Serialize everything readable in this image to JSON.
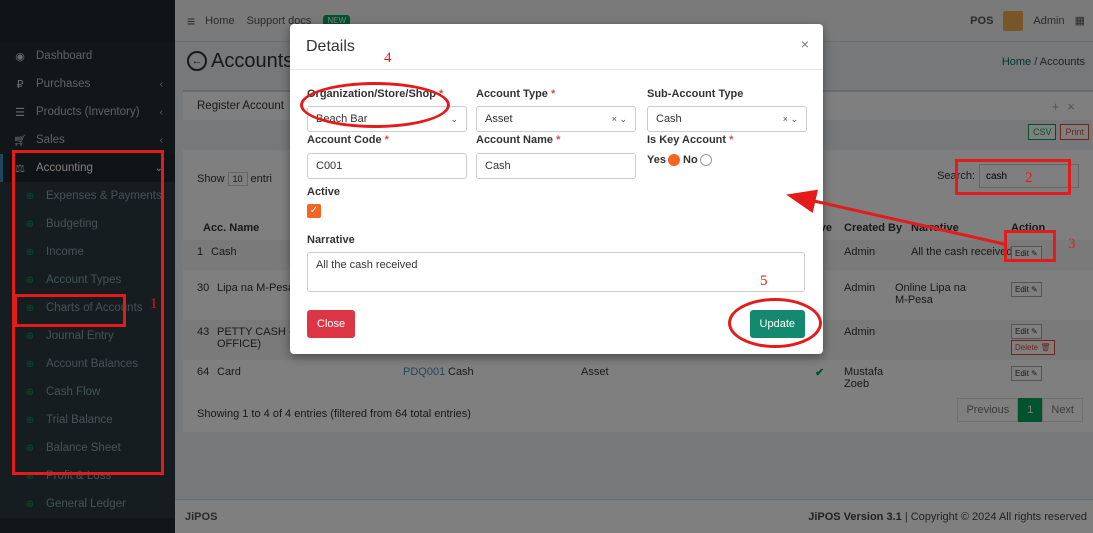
{
  "topbar": {
    "home": "Home",
    "support": "Support docs",
    "badge": "NEW",
    "pos": "POS",
    "user": "Admin",
    "grid_icon": "▦"
  },
  "sidebar": {
    "items": [
      {
        "label": "Dashboard",
        "icon": "dashboard-icon"
      },
      {
        "label": "Purchases",
        "icon": "purchases-icon"
      },
      {
        "label": "Products (Inventory)",
        "icon": "products-icon"
      },
      {
        "label": "Sales",
        "icon": "sales-icon"
      },
      {
        "label": "Accounting",
        "icon": "accounting-icon"
      }
    ],
    "subitems": [
      "Expenses & Payments",
      "Budgeting",
      "Income",
      "Account Types",
      "Charts of Accounts",
      "Journal Entry",
      "Account Balances",
      "Cash Flow",
      "Trial Balance",
      "Balance Sheet",
      "Profit & Loss",
      "General Ledger"
    ]
  },
  "page": {
    "title": "Accounts",
    "breadcrumb_home": "Home",
    "breadcrumb_sep": "/",
    "breadcrumb_current": "Accounts",
    "register_label": "Register Account",
    "csv": "CSV",
    "print": "Print",
    "show": "Show",
    "entries_select": "10",
    "entries": "entri",
    "search_label": "Search:",
    "search_value": "cash",
    "headers": {
      "acc_name": "Acc. Name",
      "active": "tive",
      "created_by": "Created By",
      "narrative": "Narrative",
      "action": "Action"
    },
    "rows": [
      {
        "id": "1",
        "name": "Cash",
        "created_by": "Admin",
        "narrative": "All the cash received",
        "edit": "Edit"
      },
      {
        "id": "30",
        "name": "Lipa na M-Pesa",
        "created_by": "Admin",
        "narrative": "Online Lipa na M-Pesa",
        "edit": "Edit"
      },
      {
        "id": "43",
        "name": "PETTY CASH - (B OFFICE)",
        "created_by": "Admin",
        "narrative": "",
        "edit": "Edit",
        "delete": "Delete"
      },
      {
        "id": "64",
        "name": "Card",
        "code": "PDQ001",
        "sub_type": "Cash",
        "type": "Asset",
        "created_by": "Mustafa Zoeb",
        "narrative": "",
        "edit": "Edit"
      }
    ],
    "info": "Showing 1 to 4 of 4 entries (filtered from 64 total entries)",
    "pager": {
      "prev": "Previous",
      "page": "1",
      "next": "Next"
    }
  },
  "footer": {
    "brand": "JiPOS",
    "version": "JiPOS Version 3.1",
    "copyright": "| Copyright © 2024 All rights reserved"
  },
  "modal": {
    "title": "Details",
    "close_x": "×",
    "org_label": "Organization/Store/Shop",
    "org_value": "Beach Bar",
    "account_type_label": "Account Type",
    "account_type_value": "Asset",
    "sub_type_label": "Sub-Account Type",
    "sub_type_value": "Cash",
    "code_label": "Account Code",
    "code_value": "C001",
    "name_label": "Account Name",
    "name_value": "Cash",
    "key_label": "Is Key Account",
    "yes": "Yes",
    "no": "No",
    "active_label": "Active",
    "narrative_label": "Narrative",
    "narrative_value": "All the cash received",
    "close_btn": "Close",
    "update_btn": "Update"
  },
  "annotations": [
    "1",
    "2",
    "3",
    "4",
    "5"
  ],
  "colors": {
    "annotation": "#e31b1b",
    "update": "#138a70",
    "close": "#dc3545",
    "accent": "#00a65a"
  }
}
